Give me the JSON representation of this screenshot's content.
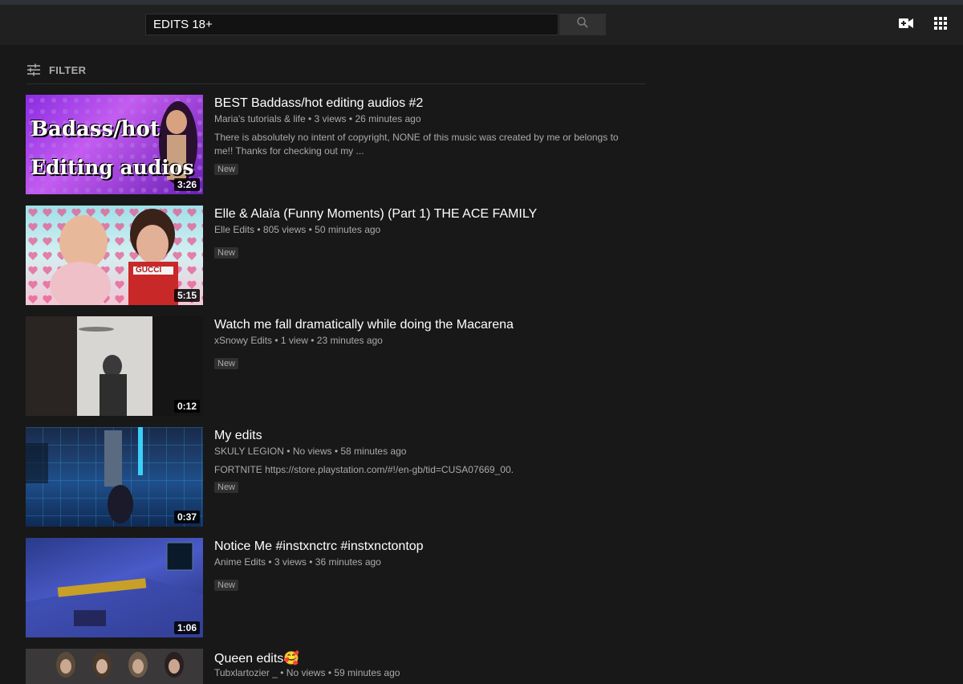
{
  "search": {
    "query": "EDITS 18+"
  },
  "filter": {
    "label": "FILTER"
  },
  "icons": {
    "search": "search-icon",
    "upload": "video-camera-plus-icon",
    "apps": "apps-grid-icon",
    "filter": "sliders-icon"
  },
  "colors": {
    "background": "#181818",
    "masthead": "#202020",
    "meta_text": "#aaaaaa"
  },
  "results": [
    {
      "title": "BEST Baddass/hot editing audios #2",
      "channel": "Maria's tutorials & life",
      "views": "3 views",
      "age": "26 minutes ago",
      "description": "There is absolutely no intent of copyright, NONE of this music was created by me or belongs to me!! Thanks for checking out my ...",
      "badge": "New",
      "duration": "3:26",
      "thumb_text_1": "Badass/hot",
      "thumb_text_2": "Editing audios"
    },
    {
      "title": "Elle & Alaïa (Funny Moments) (Part 1) THE ACE FAMILY",
      "channel": "Elle Edits",
      "views": "805 views",
      "age": "50 minutes ago",
      "description": "",
      "badge": "New",
      "duration": "5:15",
      "thumb_text_1": "GUCCI"
    },
    {
      "title": "Watch me fall dramatically while doing the Macarena",
      "channel": "xSnowy Edits",
      "views": "1 view",
      "age": "23 minutes ago",
      "description": "",
      "badge": "New",
      "duration": "0:12"
    },
    {
      "title": "My edits",
      "channel": "SKULY LEGION",
      "views": "No views",
      "age": "58 minutes ago",
      "description": "FORTNITE https://store.playstation.com/#!/en-gb/tid=CUSA07669_00.",
      "badge": "New",
      "duration": "0:37"
    },
    {
      "title": "Notice Me #instxnctrc #instxnctontop",
      "channel": "Anime Edits",
      "views": "3 views",
      "age": "36 minutes ago",
      "description": "",
      "badge": "New",
      "duration": "1:06"
    },
    {
      "title": "Queen edits🥰",
      "channel": "Tubxlartozier _",
      "views": "No views",
      "age": "59 minutes ago",
      "description": "",
      "badge": "",
      "duration": ""
    }
  ]
}
